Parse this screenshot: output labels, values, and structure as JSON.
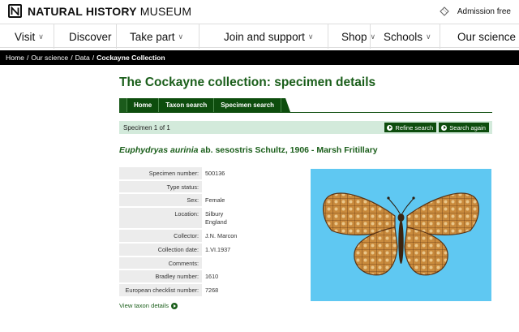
{
  "header": {
    "logo_bold": "NATURAL HISTORY",
    "logo_light": " MUSEUM",
    "admission": "Admission free"
  },
  "nav": {
    "visit": "Visit",
    "discover": "Discover",
    "take_part": "Take part",
    "join_support": "Join and support",
    "shop": "Shop",
    "schools": "Schools",
    "our_science": "Our science"
  },
  "breadcrumb": {
    "items": [
      "Home",
      "Our science",
      "Data"
    ],
    "current": "Cockayne Collection"
  },
  "page": {
    "title": "The Cockayne collection: specimen details"
  },
  "tabs": [
    "Home",
    "Taxon search",
    "Specimen search"
  ],
  "results": {
    "count_text": "Specimen 1 of 1",
    "refine_label": "Refine search",
    "search_again_label": "Search again"
  },
  "species": {
    "name_italic": "Euphydryas aurinia",
    "rest": " ab. sesostris Schultz, 1906 - Marsh Fritillary"
  },
  "details": {
    "specimen_number": {
      "label": "Specimen number:",
      "value": "500136"
    },
    "type_status": {
      "label": "Type status:",
      "value": ""
    },
    "sex": {
      "label": "Sex:",
      "value": "Female"
    },
    "location": {
      "label": "Location:",
      "line1": "Silbury",
      "line2": "England"
    },
    "collector": {
      "label": "Collector:",
      "value": "J.N. Marcon"
    },
    "collection_date": {
      "label": "Collection date:",
      "value": "1.VI.1937"
    },
    "comments": {
      "label": "Comments:",
      "value": ""
    },
    "bradley_number": {
      "label": "Bradley number:",
      "value": "1610"
    },
    "european_checklist": {
      "label": "European checklist number:",
      "value": "7268"
    }
  },
  "view_taxon_label": "View taxon details",
  "colors": {
    "brand_green": "#0d4d0d",
    "title_green": "#1a5e1a",
    "count_bar": "#d3eadb",
    "photo_background": "#5fc8f2",
    "wing_orange": "#c98a3c"
  },
  "icons": {
    "logo": "nhm-n-logo-icon",
    "ticket": "ticket-icon",
    "chevron": "chevron-down-icon",
    "arrow": "arrow-circle-icon"
  }
}
